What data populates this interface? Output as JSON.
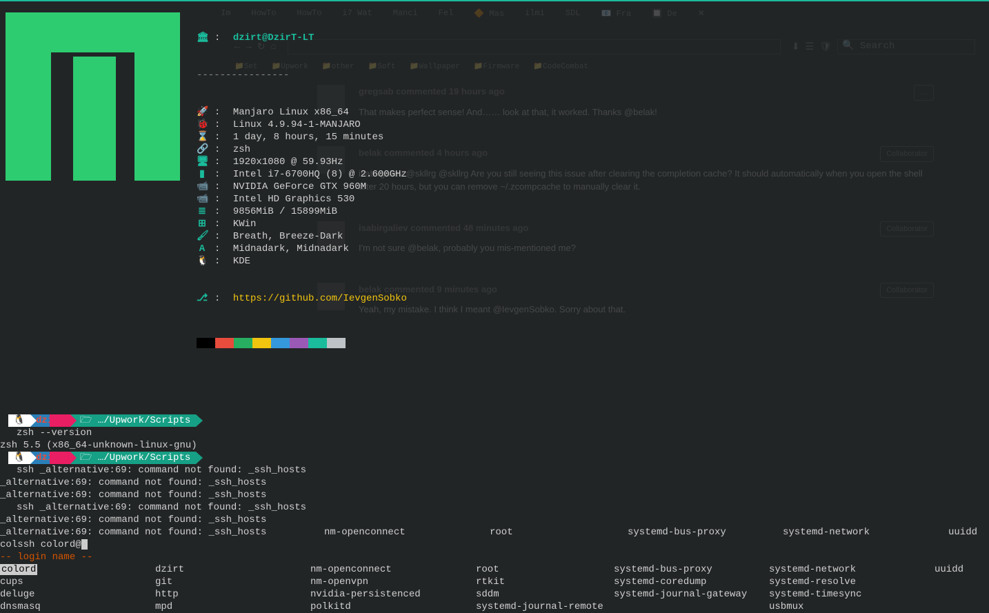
{
  "sysinfo": {
    "user_host": "dzirt@DzirT-LT",
    "lines": [
      {
        "icon": "🚀",
        "text": "Manjaro Linux x86_64"
      },
      {
        "icon": "🐞",
        "text": "Linux 4.9.94-1-MANJARO"
      },
      {
        "icon": "⌛",
        "text": "1 day, 8 hours, 15 minutes"
      },
      {
        "icon": "🔗",
        "text": "zsh"
      },
      {
        "icon": "🖥",
        "text": "1920x1080 @ 59.93Hz"
      },
      {
        "icon": "▮",
        "text": "Intel i7-6700HQ (8) @ 2.600GHz"
      },
      {
        "icon": "📹",
        "text": "NVIDIA GeForce GTX 960M"
      },
      {
        "icon": "📹",
        "text": "Intel HD Graphics 530"
      },
      {
        "icon": "≣",
        "text": "9856MiB / 15899MiB"
      },
      {
        "icon": "⊞",
        "text": "KWin"
      },
      {
        "icon": "🖌",
        "text": "Breath, Breeze-Dark"
      },
      {
        "icon": "A",
        "text": "Midnadark, Midnadark"
      },
      {
        "icon": "🐧",
        "text": "KDE"
      }
    ],
    "github_icon": "⎇",
    "github_url": "https://github.com/IevgenSobko",
    "swatches": [
      "#000000",
      "#e74c3c",
      "#27ae60",
      "#f1c40f",
      "#3498db",
      "#9b59b6",
      "#1abc9c",
      "#bdc3c7"
    ]
  },
  "prompt": {
    "user": "dzirt",
    "path": "…/Upwork/Scripts",
    "folder_icon": "🗁"
  },
  "history": {
    "cmd1": "zsh --version",
    "out1": "zsh 5.5 (x86_64-unknown-linux-gnu)",
    "cmd2_prefix": "ssh ",
    "err": "_alternative:69: command not found: _ssh_hosts",
    "current_line": "colssh colord@",
    "login_header": "-- login name --"
  },
  "completion_overlay": {
    "cols": [
      "nm-openconnect",
      "root",
      "systemd-bus-proxy",
      "systemd-network",
      "uuidd"
    ]
  },
  "completions": [
    [
      "colord",
      "dzirt",
      "nm-openconnect",
      "root",
      "systemd-bus-proxy",
      "systemd-network",
      "uuidd"
    ],
    [
      "cups",
      "git",
      "nm-openvpn",
      "rtkit",
      "systemd-coredump",
      "systemd-resolve",
      ""
    ],
    [
      "deluge",
      "http",
      "nvidia-persistenced",
      "sddm",
      "systemd-journal-gateway",
      "systemd-timesync",
      ""
    ],
    [
      "dnsmasq",
      "mpd",
      "polkitd",
      "systemd-journal-remote",
      "",
      "usbmux",
      ""
    ]
  ],
  "browser_bg": {
    "comment1_meta": "gregsab commented 19 hours ago",
    "comment1_body": "That makes perfect sense! And…… look at that, it worked. Thanks @belak!",
    "comment2_meta": "belak commented 4 hours ago",
    "comment3_body": "@skllrg Are you still seeing this issue after clearing the completion cache? It should automatically when you open the shell after 20 hours, but you can remove ~/.zcompcache to manually clear it.",
    "comment3_author": "isabirgaliev @skllrg",
    "comment4_meta": "isabirgaliev commented 48 minutes ago",
    "comment4_body": "I'm not sure @belak, probably you mis-mentioned me?",
    "comment5_meta": "belak commented 9 minutes ago",
    "comment5_body": "Yeah, my mistake. I think I meant @IevgenSobko. Sorry about that.",
    "badge": "Collaborator",
    "search_ph": "Search"
  }
}
